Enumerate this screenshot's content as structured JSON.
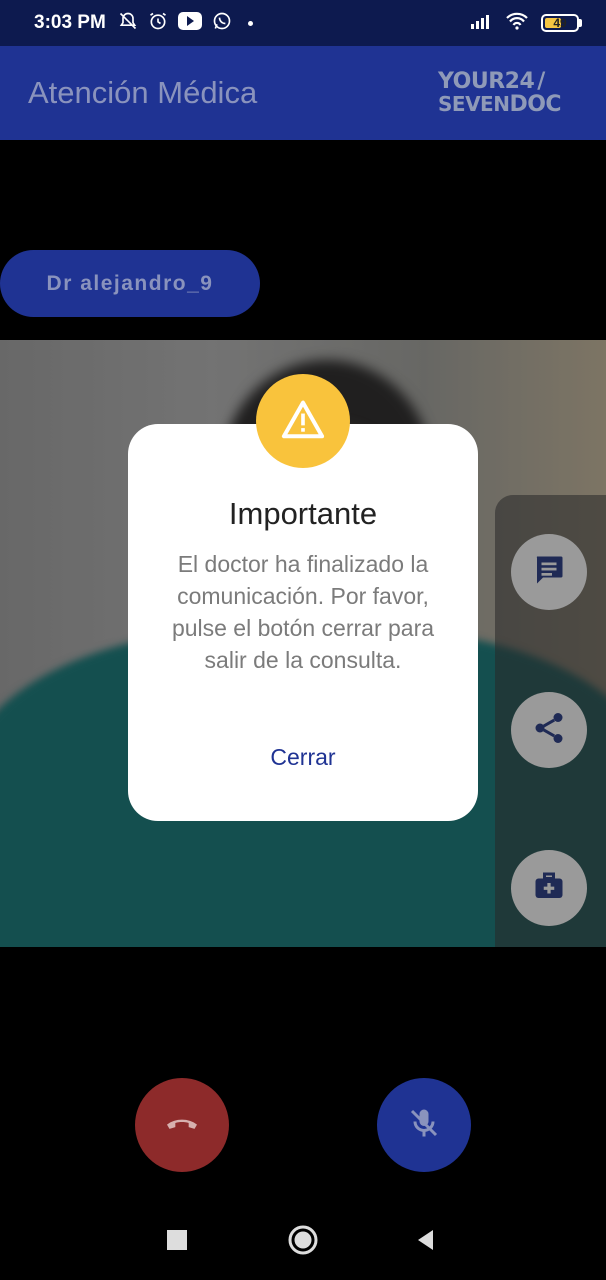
{
  "status_bar": {
    "time": "3:03 PM",
    "battery": "49",
    "icons_left": [
      "bell-off-icon",
      "alarm-icon",
      "youtube-icon",
      "whatsapp-icon"
    ],
    "icons_right": [
      "signal-icon",
      "wifi-icon",
      "battery-icon"
    ]
  },
  "app_bar": {
    "title": "Atención Médica",
    "logo_line1_a": "YOUR",
    "logo_line1_b": "24",
    "logo_line1_c": "/",
    "logo_line2_a": "SEVEN",
    "logo_line2_b": "DOC"
  },
  "doctor_chip": {
    "label": "Dr alejandro_9"
  },
  "dialog": {
    "title": "Importante",
    "message": "El doctor ha finalizado la comunicación. Por favor, pulse el botón cerrar para salir de la consulta.",
    "button": "Cerrar"
  },
  "side_actions": [
    "chat-icon",
    "share-icon",
    "medical-kit-icon"
  ],
  "call_controls": [
    "hang-up-icon",
    "mic-off-icon"
  ],
  "nav": [
    "recents-icon",
    "home-icon",
    "back-icon"
  ],
  "colors": {
    "app_bar": "#1f3393",
    "status_bar": "#0d1a4f",
    "warning": "#f9c33c",
    "hangup": "#8d2a2a",
    "accent": "#1f3393"
  }
}
